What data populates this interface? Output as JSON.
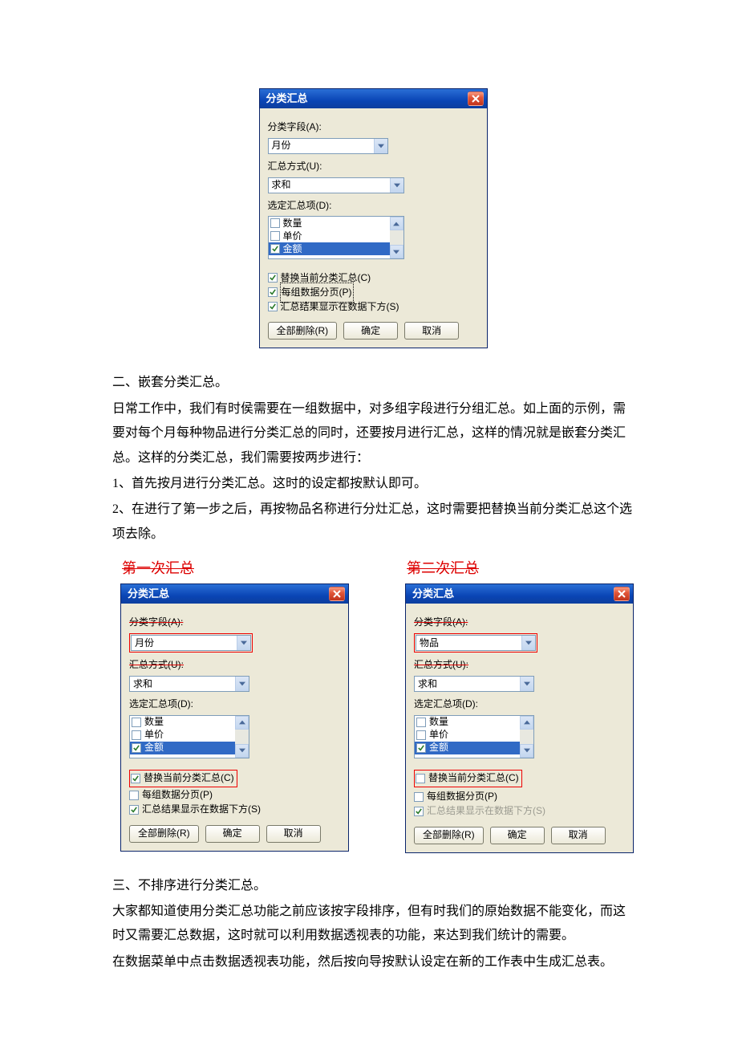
{
  "dialog": {
    "title": "分类汇总",
    "field_label": "分类字段(A):",
    "method_label": "汇总方式(U):",
    "items_label": "选定汇总项(D):",
    "list": {
      "qty": "数量",
      "price": "单价",
      "amount": "金额"
    },
    "opt_replace": "替换当前分类汇总(C)",
    "opt_page": "每组数据分页(P)",
    "opt_below": "汇总结果显示在数据下方(S)",
    "btn_removeall": "全部删除(R)",
    "btn_ok": "确定",
    "btn_cancel": "取消"
  },
  "top": {
    "field_value": "月份",
    "method_value": "求和"
  },
  "section2": {
    "heading": "二、嵌套分类汇总。",
    "p1": "日常工作中，我们有时侯需要在一组数据中，对多组字段进行分组汇总。如上面的示例，需要对每个月每种物品进行分类汇总的同时，还要按月进行汇总，这样的情况就是嵌套分类汇总。这样的分类汇总，我们需要按两步进行：",
    "p2": "1、首先按月进行分类汇总。这时的设定都按默认即可。",
    "p3": "2、在进行了第一步之后，再按物品名称进行分灶汇总，这时需要把替换当前分类汇总这个选项去除。"
  },
  "pair": {
    "left_title": "第一次汇总",
    "right_title": "第二次汇总",
    "left_field": "月份",
    "right_field": "物品",
    "method_value": "求和"
  },
  "section3": {
    "heading": "三、不排序进行分类汇总。",
    "p1": "大家都知道使用分类汇总功能之前应该按字段排序，但有时我们的原始数据不能变化，而这时又需要汇总数据，这时就可以利用数据透视表的功能，来达到我们统计的需要。",
    "p2": "在数据菜单中点击数据透视表功能，然后按向导按默认设定在新的工作表中生成汇总表。"
  }
}
